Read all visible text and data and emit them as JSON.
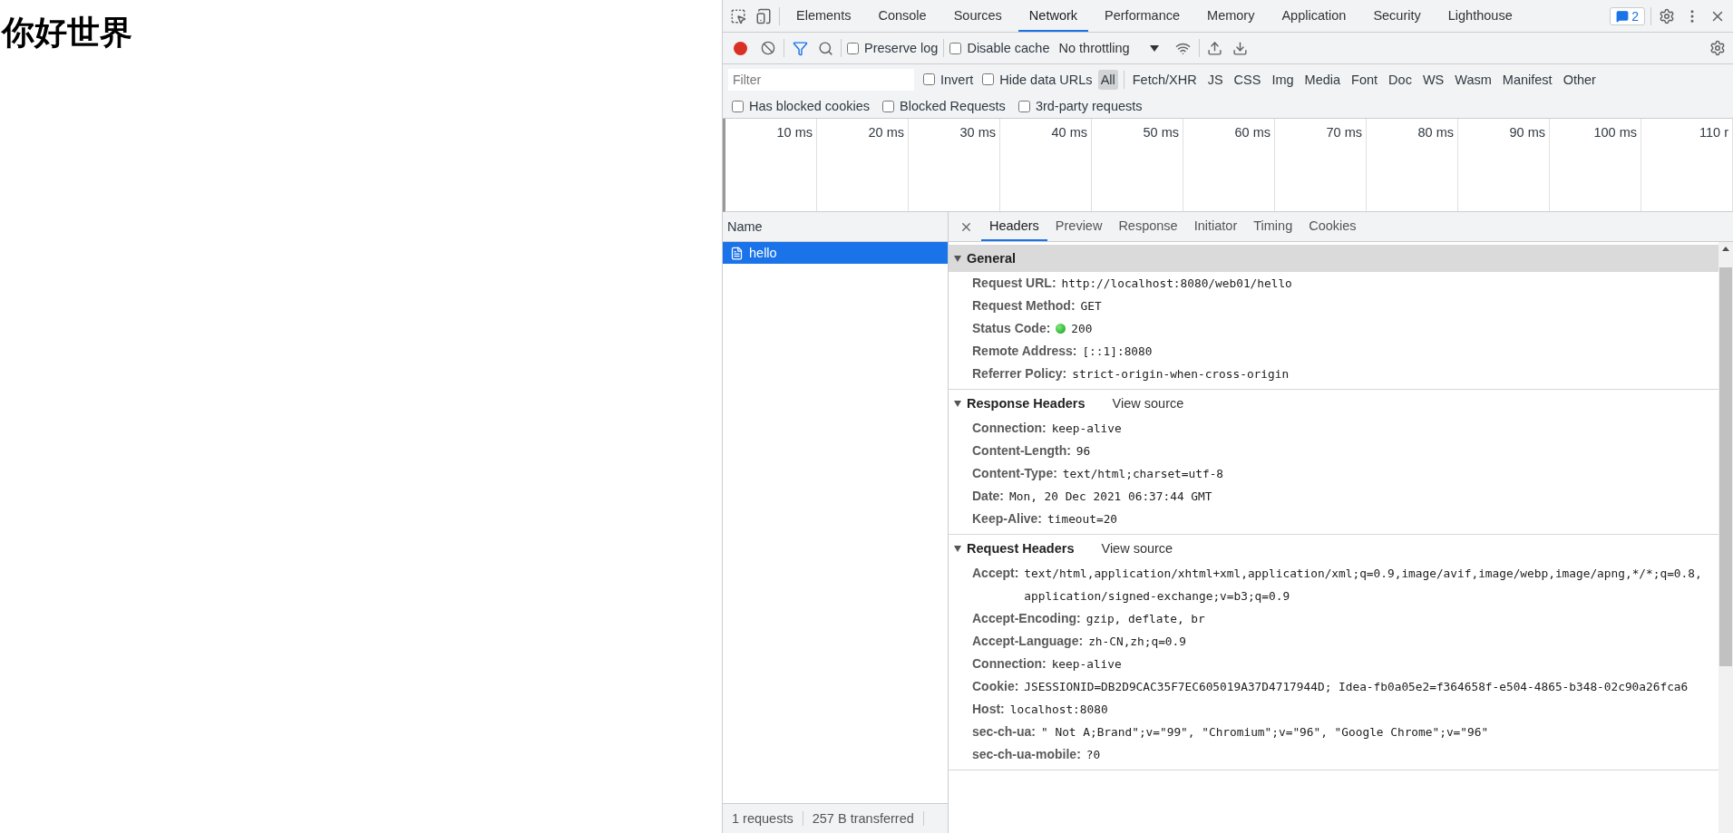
{
  "page": {
    "heading": "你好世界"
  },
  "devtools": {
    "main_tabs": [
      {
        "label": "Elements",
        "selected": false
      },
      {
        "label": "Console",
        "selected": false
      },
      {
        "label": "Sources",
        "selected": false
      },
      {
        "label": "Network",
        "selected": true
      },
      {
        "label": "Performance",
        "selected": false
      },
      {
        "label": "Memory",
        "selected": false
      },
      {
        "label": "Application",
        "selected": false
      },
      {
        "label": "Security",
        "selected": false
      },
      {
        "label": "Lighthouse",
        "selected": false
      }
    ],
    "messages_badge": "2",
    "toolbar": {
      "recording": true,
      "filter_on": true,
      "preserve_log": {
        "label": "Preserve log",
        "checked": false
      },
      "disable_cache": {
        "label": "Disable cache",
        "checked": false
      },
      "throttling": "No throttling"
    },
    "filter": {
      "placeholder": "Filter"
    },
    "filter_checks": [
      {
        "label": "Invert",
        "checked": false
      },
      {
        "label": "Hide data URLs",
        "checked": false
      }
    ],
    "type_filters": [
      {
        "label": "All",
        "selected": true
      },
      {
        "label": "Fetch/XHR",
        "selected": false
      },
      {
        "label": "JS",
        "selected": false
      },
      {
        "label": "CSS",
        "selected": false
      },
      {
        "label": "Img",
        "selected": false
      },
      {
        "label": "Media",
        "selected": false
      },
      {
        "label": "Font",
        "selected": false
      },
      {
        "label": "Doc",
        "selected": false
      },
      {
        "label": "WS",
        "selected": false
      },
      {
        "label": "Wasm",
        "selected": false
      },
      {
        "label": "Manifest",
        "selected": false
      },
      {
        "label": "Other",
        "selected": false
      }
    ],
    "extra_filters": [
      {
        "label": "Has blocked cookies",
        "checked": false
      },
      {
        "label": "Blocked Requests",
        "checked": false
      },
      {
        "label": "3rd-party requests",
        "checked": false
      }
    ],
    "timeline": {
      "ticks": [
        "10 ms",
        "20 ms",
        "30 ms",
        "40 ms",
        "50 ms",
        "60 ms",
        "70 ms",
        "80 ms",
        "90 ms",
        "100 ms",
        "110 r"
      ]
    },
    "requests": {
      "column": "Name",
      "rows": [
        {
          "name": "hello",
          "selected": true
        }
      ]
    },
    "detail_tabs": [
      {
        "label": "Headers",
        "selected": true
      },
      {
        "label": "Preview",
        "selected": false
      },
      {
        "label": "Response",
        "selected": false
      },
      {
        "label": "Initiator",
        "selected": false
      },
      {
        "label": "Timing",
        "selected": false
      },
      {
        "label": "Cookies",
        "selected": false
      }
    ],
    "sections": [
      {
        "title": "General",
        "expanded": true,
        "headers": [
          {
            "name": "Request URL:",
            "value": "http://localhost:8080/web01/hello",
            "kind": "plain"
          },
          {
            "name": "Request Method:",
            "value": "GET",
            "kind": "plain"
          },
          {
            "name": "Status Code:",
            "value": "200",
            "kind": "status"
          },
          {
            "name": "Remote Address:",
            "value": "[::1]:8080",
            "kind": "plain"
          },
          {
            "name": "Referrer Policy:",
            "value": "strict-origin-when-cross-origin",
            "kind": "plain"
          }
        ]
      },
      {
        "title": "Response Headers",
        "view_source": "View source",
        "expanded": true,
        "headers": [
          {
            "name": "Connection:",
            "value": "keep-alive"
          },
          {
            "name": "Content-Length:",
            "value": "96"
          },
          {
            "name": "Content-Type:",
            "value": "text/html;charset=utf-8"
          },
          {
            "name": "Date:",
            "value": "Mon, 20 Dec 2021 06:37:44 GMT"
          },
          {
            "name": "Keep-Alive:",
            "value": "timeout=20"
          }
        ]
      },
      {
        "title": "Request Headers",
        "view_source": "View source",
        "expanded": true,
        "headers": [
          {
            "name": "Accept:",
            "value": "text/html,application/xhtml+xml,application/xml;q=0.9,image/avif,image/webp,image/apng,*/*;q=0.8,application/signed-exchange;v=b3;q=0.9"
          },
          {
            "name": "Accept-Encoding:",
            "value": "gzip, deflate, br"
          },
          {
            "name": "Accept-Language:",
            "value": "zh-CN,zh;q=0.9"
          },
          {
            "name": "Connection:",
            "value": "keep-alive"
          },
          {
            "name": "Cookie:",
            "value": "JSESSIONID=DB2D9CAC35F7EC605019A37D4717944D; Idea-fb0a05e2=f364658f-e504-4865-b348-02c90a26fca6"
          },
          {
            "name": "Host:",
            "value": "localhost:8080"
          },
          {
            "name": "sec-ch-ua:",
            "value": "\" Not A;Brand\";v=\"99\", \"Chromium\";v=\"96\", \"Google Chrome\";v=\"96\""
          },
          {
            "name": "sec-ch-ua-mobile:",
            "value": "?0"
          }
        ]
      }
    ],
    "status_bar": [
      "1 requests",
      "257 B transferred"
    ]
  }
}
